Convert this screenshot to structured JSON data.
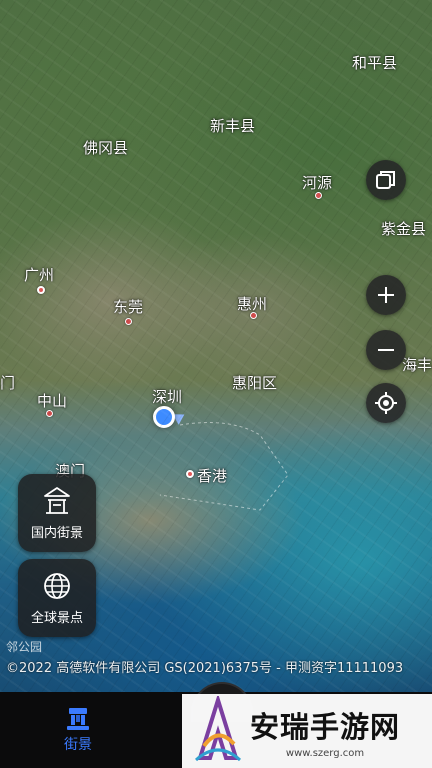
{
  "map": {
    "cities": [
      {
        "id": "heping",
        "label": "和平县"
      },
      {
        "id": "xinfeng",
        "label": "新丰县"
      },
      {
        "id": "fogang",
        "label": "佛冈县"
      },
      {
        "id": "heyuan",
        "label": "河源"
      },
      {
        "id": "zijin",
        "label": "紫金县"
      },
      {
        "id": "guangzhou",
        "label": "广州"
      },
      {
        "id": "dongguan",
        "label": "东莞"
      },
      {
        "id": "huizhou",
        "label": "惠州"
      },
      {
        "id": "zhongshan",
        "label": "中山"
      },
      {
        "id": "shenzhen",
        "label": "深圳"
      },
      {
        "id": "huiyang",
        "label": "惠阳区"
      },
      {
        "id": "aomen",
        "label": "澳门"
      },
      {
        "id": "xianggang",
        "label": "香港"
      },
      {
        "id": "haifeng-partial",
        "label": "海丰县"
      },
      {
        "id": "jiangmen-partial",
        "label": "门"
      }
    ],
    "copyright": "©2022 高德软件有限公司 GS(2021)6375号 - 甲测资字11111093",
    "bottom_left_partial": "邻公园"
  },
  "controls": {
    "layers_icon": "layers-icon",
    "zoom_in_icon": "plus-icon",
    "zoom_out_icon": "minus-icon",
    "locate_icon": "locate-icon"
  },
  "cards": {
    "domestic": {
      "label": "国内街景",
      "icon": "pavilion-icon"
    },
    "global": {
      "label": "全球景点",
      "icon": "globe-icon"
    }
  },
  "tabbar": {
    "streetview_label": "街景",
    "accent": "#3b7bff"
  },
  "watermark": {
    "title": "安瑞手游网",
    "url": "www.szerg.com"
  }
}
